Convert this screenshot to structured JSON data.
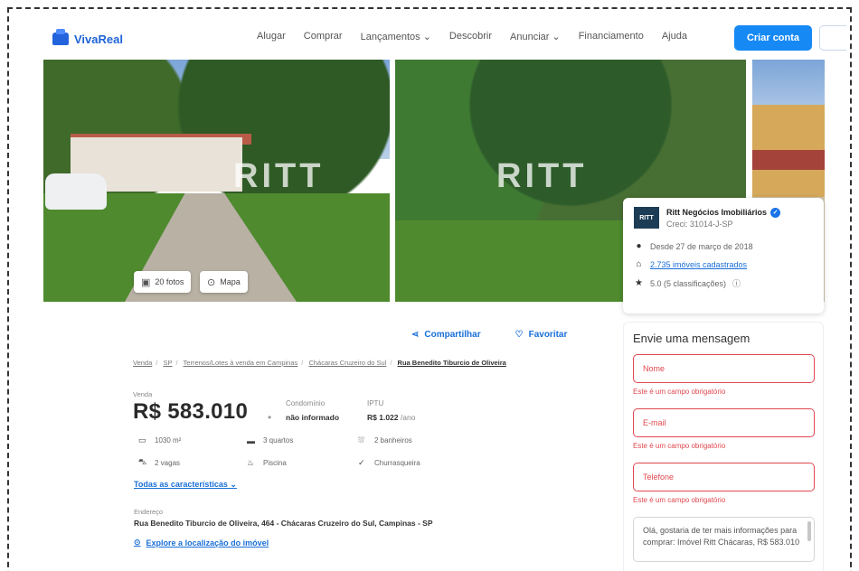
{
  "header": {
    "logo_text": "VivaReal",
    "nav": [
      "Alugar",
      "Comprar",
      "Lançamentos ⌄",
      "Descobrir",
      "Anunciar ⌄",
      "Financiamento",
      "Ajuda"
    ],
    "cta_label": "Criar conta"
  },
  "photos": {
    "watermark": "RITT",
    "count_label": "20 fotos",
    "map_label": "Mapa"
  },
  "agent": {
    "logo": "RITT",
    "name": "Ritt Negócios Imobiliários",
    "creci": "Creci: 31014-J-SP",
    "since": "Desde 27 de março de 2018",
    "listings": "2.735 imóveis cadastrados",
    "rating": "5.0 (5 classificações)"
  },
  "form": {
    "title": "Envie uma mensagem",
    "name_placeholder": "Nome",
    "email_placeholder": "E-mail",
    "phone_placeholder": "Telefone",
    "required_error": "Este é um campo obrigatório",
    "message": "Olá, gostaria de ter mais informações para comprar: Imóvel Ritt Chácaras, R$ 583.010"
  },
  "actions": {
    "share": "Compartilhar",
    "favorite": "Favoritar"
  },
  "breadcrumb": [
    "Venda",
    "SP",
    "Terrenos/Lotes à venda em Campinas",
    "Chácaras Cruzeiro do Sul",
    "Rua Benedito Tiburcio de Oliveira"
  ],
  "listing": {
    "price_label": "Venda",
    "price": "R$ 583.010",
    "condo_label": "Condomínio",
    "condo_value": "não informado",
    "iptu_label": "IPTU",
    "iptu_value": "R$ 1.022",
    "iptu_suffix": "/ano",
    "features": [
      {
        "icon": "area-icon",
        "glyph": "▭",
        "label": "1030 m²"
      },
      {
        "icon": "bed-icon",
        "glyph": "▬",
        "label": "3 quartos"
      },
      {
        "icon": "shower-icon",
        "glyph": "⛆",
        "label": "2 banheiros"
      },
      {
        "icon": "car-icon",
        "glyph": "⛍",
        "label": "2 vagas"
      },
      {
        "icon": "pool-icon",
        "glyph": "♨",
        "label": "Piscina"
      },
      {
        "icon": "check-icon",
        "glyph": "✓",
        "label": "Churrasqueira"
      }
    ],
    "all_features_label": "Todas as características ⌄",
    "address_label": "Endereço",
    "address": "Rua Benedito Tiburcio de Oliveira, 464 - Chácaras Cruzeiro do Sul, Campinas - SP",
    "explore_label": "Explore a localização do imóvel"
  },
  "colors": {
    "brand": "#1f63d8",
    "cta": "#1689f5",
    "error": "#e0484f",
    "link": "#1a6fd8"
  }
}
